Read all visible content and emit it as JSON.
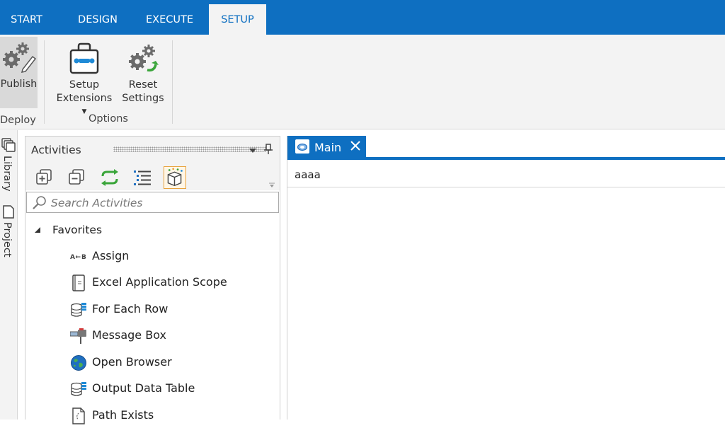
{
  "tabs": [
    {
      "label": "START"
    },
    {
      "label": "DESIGN"
    },
    {
      "label": "EXECUTE"
    },
    {
      "label": "SETUP",
      "active": true
    }
  ],
  "ribbon": {
    "publish": {
      "label": "Publish",
      "icon": "gears-pencil-icon"
    },
    "deploy_group": "Deploy",
    "setup_extensions": {
      "line1": "Setup",
      "line2": "Extensions",
      "icon": "toolbox-icon"
    },
    "reset_settings": {
      "line1": "Reset",
      "line2": "Settings",
      "icon": "gears-reset-icon"
    },
    "options_group": "Options"
  },
  "left_dock": {
    "library": "Library",
    "project": "Project"
  },
  "activities": {
    "title": "Activities",
    "search_placeholder": "Search Activities",
    "favorites_label": "Favorites",
    "items": [
      {
        "label": "Assign",
        "icon": "assign-icon"
      },
      {
        "label": "Excel Application Scope",
        "icon": "excel-scope-icon"
      },
      {
        "label": "For Each Row",
        "icon": "database-rows-icon"
      },
      {
        "label": "Message Box",
        "icon": "message-box-icon"
      },
      {
        "label": "Open Browser",
        "icon": "globe-icon"
      },
      {
        "label": "Output Data Table",
        "icon": "database-table-icon"
      },
      {
        "label": "Path Exists",
        "icon": "file-exists-icon"
      }
    ]
  },
  "designer": {
    "tab_title": "Main",
    "annotation_text": "aaaa"
  },
  "colors": {
    "accent": "#0e6fc1",
    "ribbon_bg": "#f3f3f3",
    "highlight_border": "#e8a33d"
  }
}
